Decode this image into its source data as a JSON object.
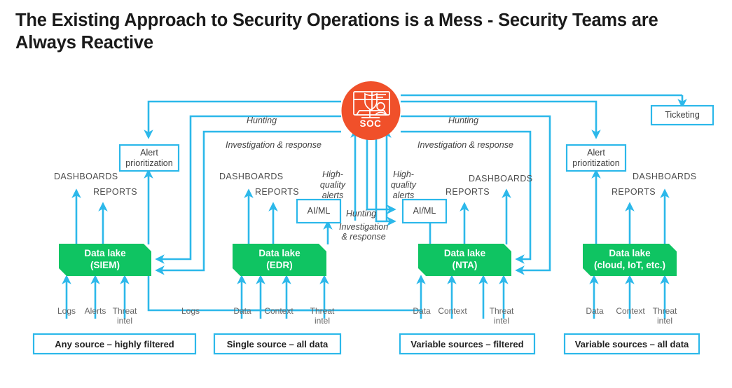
{
  "title": "The Existing Approach to Security Operations is a Mess - Security Teams are Always Reactive",
  "colors": {
    "orange": "#F0502A",
    "green": "#0FC462",
    "blue": "#2CB8EA",
    "text_gray": "#555555",
    "title_black": "#1a1a1a"
  },
  "hub": {
    "label": "SOC",
    "icon": "soc-monitor-shield-icon"
  },
  "boxes": {
    "ticketing": "Ticketing",
    "alert_prioritization_left": "Alert\nprioritization",
    "alert_prioritization_right": "Alert\nprioritization",
    "aiml_left": "AI/ML",
    "aiml_right": "AI/ML"
  },
  "flow_labels": {
    "hunting_left": "Hunting",
    "hunting_right": "Hunting",
    "hunting_center": "Hunting",
    "investigation_left": "Investigation & response",
    "investigation_right": "Investigation & response",
    "investigation_center": "Investigation\n& response",
    "high_quality_alerts_left": "High-\nquality\nalerts",
    "high_quality_alerts_right": "High-\nquality\nalerts"
  },
  "columns": [
    {
      "id": "siem",
      "datalake_line1": "Data lake",
      "datalake_line2": "(SIEM)",
      "outputs": [
        {
          "name": "dashboards",
          "label": "DASHBOARDS"
        },
        {
          "name": "reports",
          "label": "REPORTS"
        }
      ],
      "inputs": [
        "Logs",
        "Alerts",
        "Threat\nintel"
      ],
      "source": "Any source – highly filtered"
    },
    {
      "id": "edr",
      "datalake_line1": "Data lake",
      "datalake_line2": "(EDR)",
      "outputs": [
        {
          "name": "dashboards",
          "label": "DASHBOARDS"
        },
        {
          "name": "reports",
          "label": "REPORTS"
        }
      ],
      "inputs": [
        "Data",
        "Context",
        "Threat\nintel"
      ],
      "extra_input_label": "Logs",
      "source": "Single source – all data"
    },
    {
      "id": "nta",
      "datalake_line1": "Data lake",
      "datalake_line2": "(NTA)",
      "outputs": [
        {
          "name": "reports",
          "label": "REPORTS"
        },
        {
          "name": "dashboards",
          "label": "DASHBOARDS"
        }
      ],
      "inputs": [
        "Data",
        "Context",
        "Threat\nintel"
      ],
      "source": "Variable sources – filtered"
    },
    {
      "id": "cloud",
      "datalake_line1": "Data lake",
      "datalake_line2": "(cloud, IoT, etc.)",
      "outputs": [
        {
          "name": "reports",
          "label": "REPORTS"
        },
        {
          "name": "dashboards",
          "label": "DASHBOARDS"
        }
      ],
      "inputs": [
        "Data",
        "Context",
        "Threat\nintel"
      ],
      "source": "Variable sources – all data"
    }
  ]
}
